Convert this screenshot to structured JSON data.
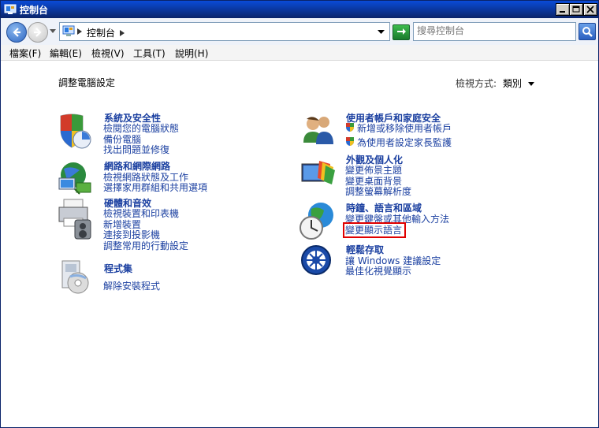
{
  "window": {
    "title": "控制台",
    "controls": [
      "minimize",
      "maximize",
      "close"
    ]
  },
  "address": {
    "crumb": "控制台",
    "search_placeholder": "搜尋控制台"
  },
  "menu": {
    "items": [
      "檔案(F)",
      "編輯(E)",
      "檢視(V)",
      "工具(T)",
      "說明(H)"
    ]
  },
  "page": {
    "title": "調整電腦設定",
    "view_by_label": "檢視方式:",
    "view_by_value": "類別"
  },
  "categories": {
    "system": {
      "heading": "系統及安全性",
      "links": [
        "檢閱您的電腦狀態",
        "備份電腦",
        "找出問題並修復"
      ]
    },
    "network": {
      "heading": "網路和網際網路",
      "links": [
        "檢視網路狀態及工作",
        "選擇家用群組和共用選項"
      ]
    },
    "hardware": {
      "heading": "硬體和音效",
      "links": [
        "檢視裝置和印表機",
        "新增裝置",
        "連接到投影機",
        "調整常用的行動設定"
      ]
    },
    "programs": {
      "heading": "程式集",
      "links": [
        "解除安裝程式"
      ]
    },
    "users": {
      "heading": "使用者帳戶和家庭安全",
      "links": [
        "新增或移除使用者帳戶",
        "為使用者設定家長監護"
      ]
    },
    "appearance": {
      "heading": "外觀及個人化",
      "links": [
        "變更佈景主題",
        "變更桌面背景",
        "調整螢幕解析度"
      ]
    },
    "clock": {
      "heading": "時鐘、語言和區域",
      "links": [
        "變更鍵盤或其他輸入方法",
        "變更顯示語言"
      ]
    },
    "ease": {
      "heading": "輕鬆存取",
      "links": [
        "讓 Windows 建議設定",
        "最佳化視覺顯示"
      ]
    }
  },
  "colors": {
    "link": "#1a3fa0",
    "title_bar": "#0a246a",
    "highlight": "#e00000"
  }
}
